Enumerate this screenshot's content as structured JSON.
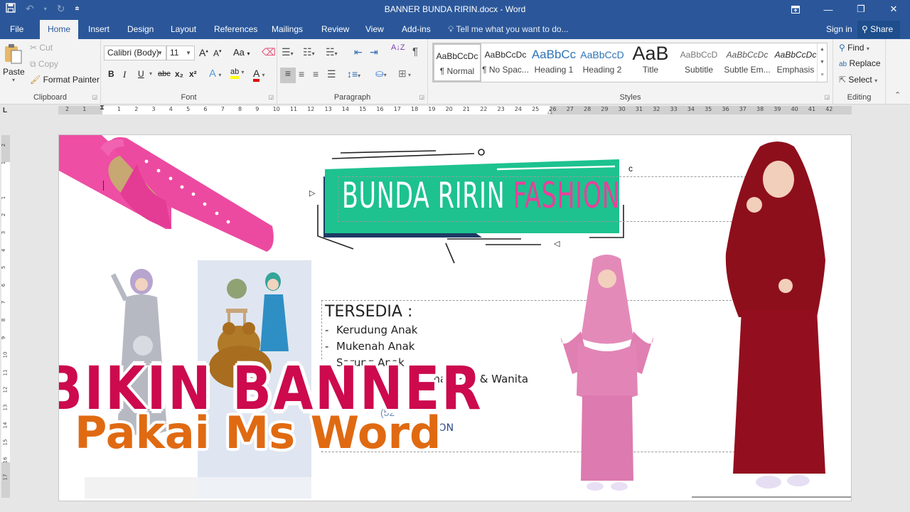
{
  "window": {
    "title": "BANNER BUNDA RIRIN.docx - Word",
    "qat": {
      "save": "save-icon",
      "undo": "undo-icon",
      "redo": "redo-icon",
      "customize": "customize-qat-icon"
    },
    "controls": {
      "ribbon_display": "ribbon-display-icon",
      "minimize": "—",
      "restore": "❐",
      "close": "✕"
    }
  },
  "tabs": [
    {
      "label": "File",
      "active": false
    },
    {
      "label": "Home",
      "active": true
    },
    {
      "label": "Insert",
      "active": false
    },
    {
      "label": "Design",
      "active": false
    },
    {
      "label": "Layout",
      "active": false
    },
    {
      "label": "References",
      "active": false
    },
    {
      "label": "Mailings",
      "active": false
    },
    {
      "label": "Review",
      "active": false
    },
    {
      "label": "View",
      "active": false
    },
    {
      "label": "Add-ins",
      "active": false
    }
  ],
  "tell_me": "Tell me what you want to do...",
  "sign_in": "Sign in",
  "share": "Share",
  "ribbon": {
    "clipboard": {
      "label": "Clipboard",
      "paste": "Paste",
      "cut": "Cut",
      "copy": "Copy",
      "format_painter": "Format Painter"
    },
    "font": {
      "label": "Font",
      "font_name": "Calibri (Body)",
      "font_size": "11",
      "grow": "A",
      "shrink": "A",
      "change_case": "Aa",
      "bold": "B",
      "italic": "I",
      "underline": "U",
      "strike": "abc",
      "subscript": "x₂",
      "superscript": "x²",
      "text_effects": "A",
      "highlight": "ab",
      "font_color": "A",
      "highlight_color": "#ffff00",
      "font_color_value": "#e00000"
    },
    "paragraph": {
      "label": "Paragraph",
      "pilcrow": "¶",
      "sort": "A↓Z"
    },
    "styles": {
      "label": "Styles",
      "items": [
        {
          "preview": "AaBbCcDc",
          "name": "¶ Normal",
          "selected": true
        },
        {
          "preview": "AaBbCcDc",
          "name": "¶ No Spac...",
          "selected": false
        },
        {
          "preview": "AaBbCc",
          "name": "Heading 1",
          "selected": false
        },
        {
          "preview": "AaBbCcD",
          "name": "Heading 2",
          "selected": false
        },
        {
          "preview": "AaB",
          "name": "Title",
          "selected": false
        },
        {
          "preview": "AaBbCcD",
          "name": "Subtitle",
          "selected": false
        },
        {
          "preview": "AaBbCcDc",
          "name": "Subtle Em...",
          "selected": false
        },
        {
          "preview": "AaBbCcDc",
          "name": "Emphasis",
          "selected": false
        }
      ]
    },
    "editing": {
      "label": "Editing",
      "find": "Find",
      "replace": "Replace",
      "select": "Select"
    }
  },
  "ruler": {
    "h_numbers": [
      "2",
      "1",
      "",
      "1",
      "2",
      "3",
      "4",
      "5",
      "6",
      "7",
      "8",
      "9",
      "10",
      "11",
      "12",
      "13",
      "14",
      "15",
      "16",
      "17",
      "18",
      "19",
      "20",
      "21",
      "22",
      "23",
      "24",
      "25",
      "26",
      "27",
      "28",
      "29",
      "30",
      "31",
      "32",
      "33",
      "34",
      "35",
      "36",
      "37",
      "38",
      "39",
      "40",
      "41",
      "42"
    ],
    "v_numbers": [
      "2",
      "1",
      "",
      "1",
      "2",
      "3",
      "4",
      "5",
      "6",
      "7",
      "8",
      "9",
      "10",
      "11",
      "12",
      "13",
      "14",
      "15",
      "16",
      "17"
    ],
    "tab_selector": "L"
  },
  "document": {
    "brand_white": "BUNDA RIRIN",
    "brand_pink": "FASHION",
    "tersedia_heading": "TERSEDIA :",
    "tersedia_items": [
      "Kerudung Anak",
      "Mukenah Anak",
      "Sarung Anak",
      "n Anak Pria & Wanita"
    ],
    "partial_number": "(52",
    "footer_fragment": "SHION",
    "colors": {
      "teal": "#1dc28f",
      "navy": "#1e3a64",
      "pink": "#e8409a",
      "crimson": "#cc0a4d",
      "orange": "#e06a12"
    }
  },
  "overlay": {
    "line1": "BIKIN BANNER",
    "line2": "Pakai Ms Word"
  }
}
